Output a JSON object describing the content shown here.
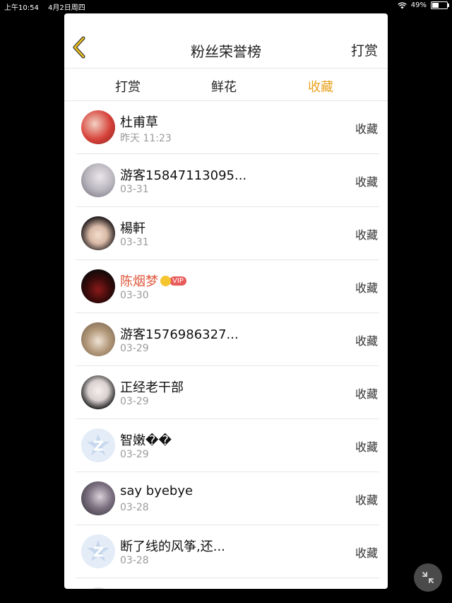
{
  "status": {
    "time": "上午10:54",
    "date": "4月2日周四",
    "battery": "49%",
    "battery_level": 0.49
  },
  "header": {
    "title": "粉丝荣誉榜",
    "right_action": "打赏"
  },
  "tabs": [
    {
      "label": "打赏",
      "active": false
    },
    {
      "label": "鲜花",
      "active": false
    },
    {
      "label": "收藏",
      "active": true
    }
  ],
  "colors": {
    "accent": "#e9a21d",
    "vip_name": "#e0573b"
  },
  "rows": [
    {
      "name": "杜甫草",
      "date": "昨天 11:23",
      "action": "收藏"
    },
    {
      "name": "游客15847113095...",
      "date": "03-31",
      "action": "收藏"
    },
    {
      "name": "楊軒",
      "date": "03-31",
      "action": "收藏"
    },
    {
      "name": "陈烟梦",
      "date": "03-30",
      "action": "收藏",
      "vip_label": "VIP"
    },
    {
      "name": "游客1576986327...",
      "date": "03-29",
      "action": "收藏"
    },
    {
      "name": "正经老干部",
      "date": "03-29",
      "action": "收藏"
    },
    {
      "name": "智嫩��",
      "date": "03-29",
      "action": "收藏"
    },
    {
      "name": "say byebye",
      "date": "03-28",
      "action": "收藏"
    },
    {
      "name": "断了线的风筝,还...",
      "date": "03-28",
      "action": "收藏"
    }
  ]
}
